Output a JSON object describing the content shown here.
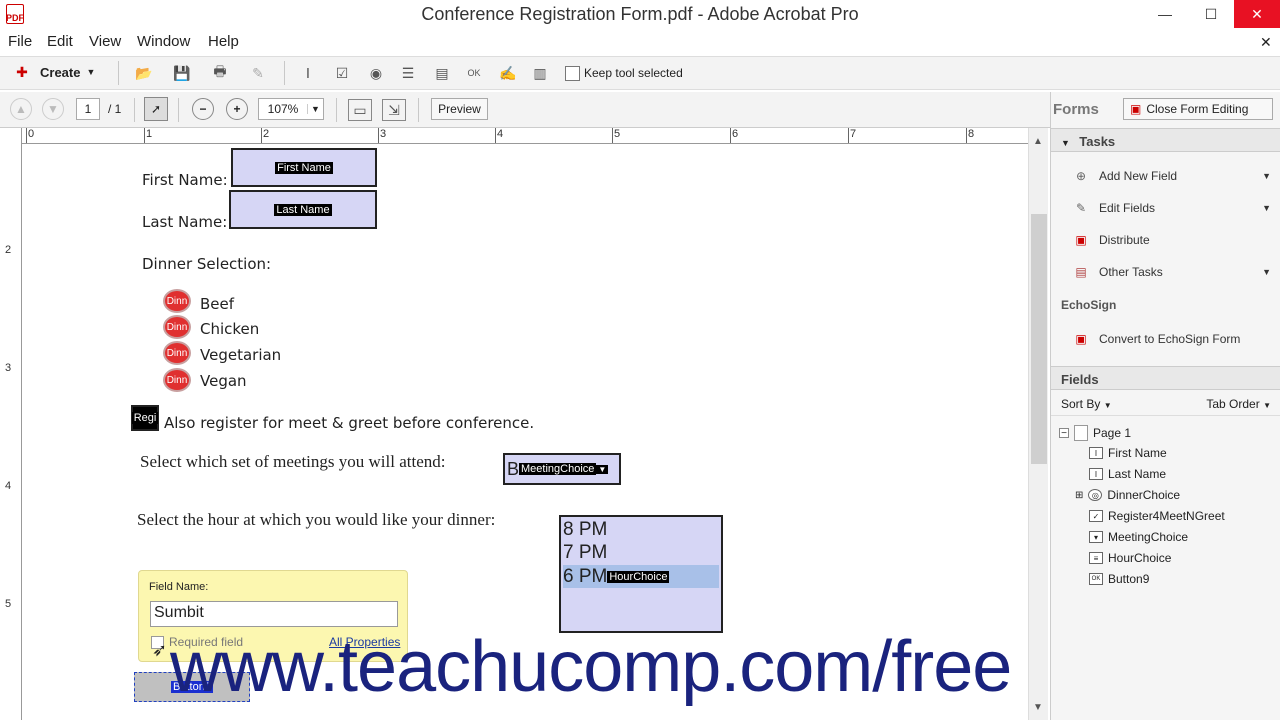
{
  "window": {
    "title": "Conference Registration Form.pdf - Adobe Acrobat Pro",
    "min": "—",
    "max": "☐",
    "close": "✕"
  },
  "menu": [
    "File",
    "Edit",
    "View",
    "Window",
    "Help"
  ],
  "toolbar1": {
    "create_label": "Create",
    "keep_tool_label": "Keep tool selected"
  },
  "toolbar2": {
    "page_current": "1",
    "page_total": "/ 1",
    "zoom": "107%",
    "preview_label": "Preview",
    "forms_label": "Forms",
    "close_form_editing_label": "Close Form Editing"
  },
  "ruler": {
    "h_ticks": [
      "0",
      "1",
      "2",
      "3",
      "4",
      "5",
      "6",
      "7",
      "8"
    ],
    "v_ticks": [
      "2",
      "3",
      "4",
      "5"
    ]
  },
  "form": {
    "first_name_label": "First Name:",
    "first_name_field": "First Name",
    "last_name_label": "Last Name:",
    "last_name_field": "Last Name",
    "dinner_selection_label": "Dinner Selection:",
    "dinner_options": [
      "Beef",
      "Chicken",
      "Vegetarian",
      "Vegan"
    ],
    "radio_tag": "Dinn",
    "register_tag": "Regi",
    "register_label": "Also register for meet & greet before conference.",
    "meetings_label": "Select which set of meetings you will attend:",
    "meeting_field_prefix": "B",
    "meeting_field_tag": "MeetingChoice",
    "hour_label": "Select the hour at which you would like your dinner:",
    "hour_options": [
      "8 PM",
      "7 PM",
      "6 PM"
    ],
    "hour_field_tag": "HourChoice",
    "button_tag": "Button9"
  },
  "popup": {
    "field_name_label": "Field Name:",
    "field_name_value": "Sumbit",
    "required_label": "Required field",
    "all_properties_label": "All Properties"
  },
  "panel": {
    "tasks_title": "Tasks",
    "tasks": [
      "Add New Field",
      "Edit Fields",
      "Distribute",
      "Other Tasks"
    ],
    "echosign_title": "EchoSign",
    "echosign_item": "Convert to EchoSign Form",
    "fields_title": "Fields",
    "sort_by": "Sort By",
    "tab_order": "Tab Order",
    "page_node": "Page 1",
    "fields": [
      "First Name",
      "Last Name",
      "DinnerChoice",
      "Register4MeetNGreet",
      "MeetingChoice",
      "HourChoice",
      "Button9"
    ]
  },
  "watermark": "www.teachucomp.com/free"
}
